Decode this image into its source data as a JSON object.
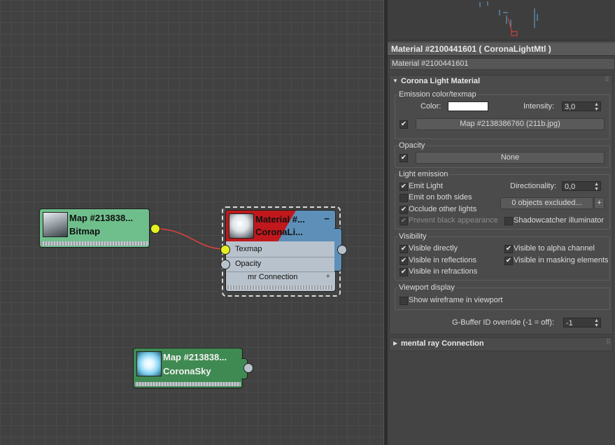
{
  "graph": {
    "bitmap_node": {
      "title_line1": "Map #213838...",
      "title_line2": "Bitmap"
    },
    "material_node": {
      "title_line1": "Material #...",
      "title_line2": "CoronaLi...",
      "collapse": "−",
      "slots": [
        "Texmap",
        "Opacity"
      ],
      "footer": "mr Connection",
      "footer_plus": "+"
    },
    "sky_node": {
      "title_line1": "Map #213838...",
      "title_line2": "CoronaSky"
    }
  },
  "panel": {
    "header": "Material #2100441601  ( CoronaLightMtl )",
    "name_field": "Material #2100441601",
    "rollout_title": "Corona Light Material",
    "rollout_arrow": "▼",
    "emission": {
      "group": "Emission color/texmap",
      "color_label": "Color:",
      "color_value": "#ffffff",
      "intensity_label": "Intensity:",
      "intensity_value": "3,0",
      "map_checked": "✔",
      "map_button": "Map #2138386760 (211b.jpg)"
    },
    "opacity": {
      "group": "Opacity",
      "checked": "✔",
      "button": "None"
    },
    "light_emission": {
      "group": "Light emission",
      "emit_light": "Emit Light",
      "emit_both": "Emit on both sides",
      "occlude": "Occlude other lights",
      "prevent_black": "Prevent black appearance",
      "shadowcatcher": "Shadowcatcher illuminator",
      "directionality_label": "Directionality:",
      "directionality_value": "0,0",
      "excluded_button": "0 objects excluded...",
      "plus": "+"
    },
    "visibility": {
      "group": "Visibility",
      "directly": "Visible directly",
      "reflections": "Visible in reflections",
      "refractions": "Visible in refractions",
      "alpha": "Visible to alpha channel",
      "masking": "Visible in masking elements"
    },
    "viewport": {
      "group": "Viewport display",
      "wireframe": "Show wireframe in viewport"
    },
    "gbuffer_label": "G-Buffer ID override (-1 = off):",
    "gbuffer_value": "-1",
    "mr_rollout_title": "mental ray Connection",
    "mr_rollout_arrow": "▶"
  },
  "colors": {
    "bitmap_node": "#6fbf8c",
    "sky_node": "#3f8a52",
    "material_node_body": "#5d8fb8",
    "material_header_red": "#c0181c",
    "connection_wire": "#e04040",
    "active_socket": "#e5f020"
  }
}
